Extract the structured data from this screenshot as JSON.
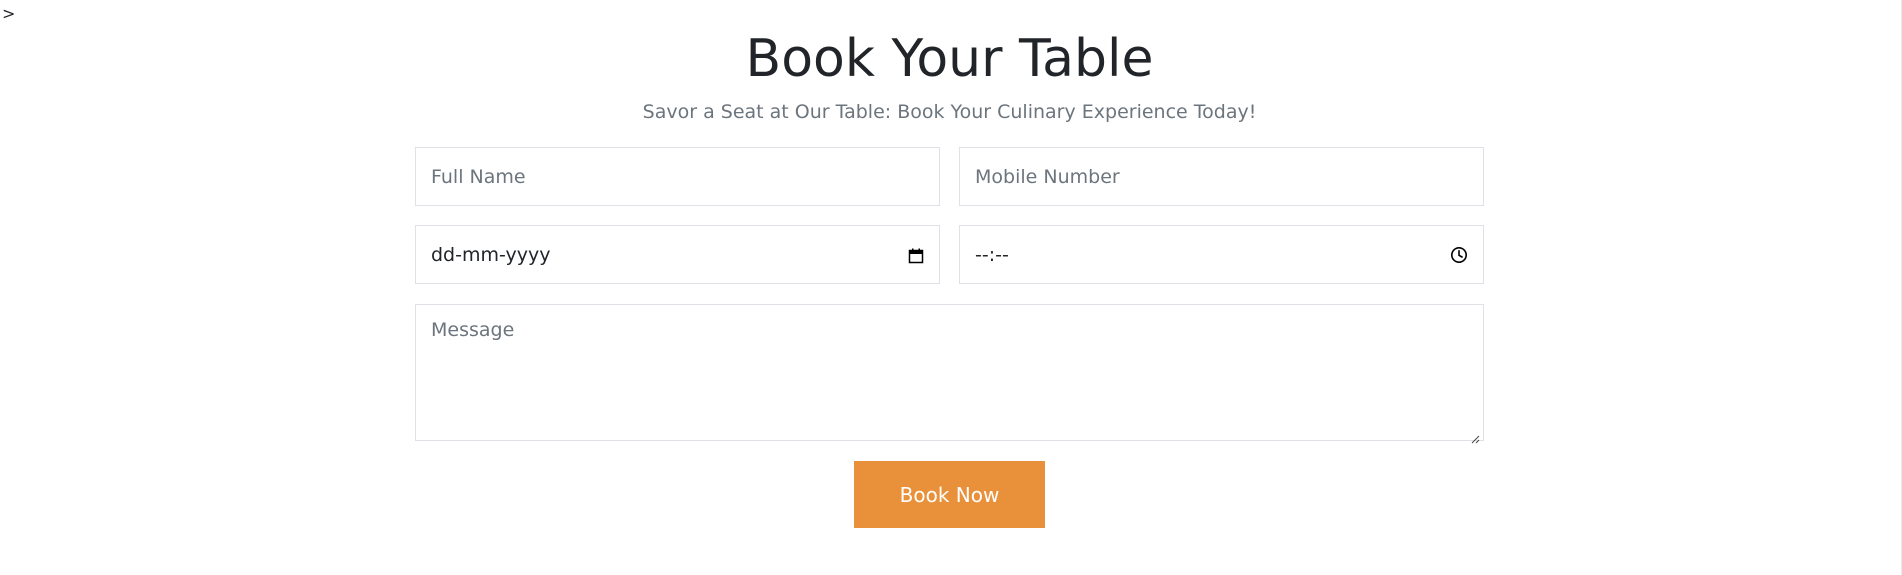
{
  "stray_text": ">",
  "booking": {
    "title": "Book Your Table",
    "subtitle": "Savor a Seat at Our Table: Book Your Culinary Experience Today!",
    "fields": {
      "full_name": {
        "placeholder": "Full Name"
      },
      "mobile": {
        "placeholder": "Mobile Number"
      },
      "date": {
        "value": "dd-mm-yyyy",
        "icon": "calendar-icon"
      },
      "time": {
        "value": "--:--",
        "icon": "clock-icon"
      },
      "message": {
        "placeholder": "Message"
      }
    },
    "submit_label": "Book Now"
  },
  "colors": {
    "accent": "#e8913a",
    "muted_text": "#6c757d",
    "border": "#dee2e6"
  }
}
